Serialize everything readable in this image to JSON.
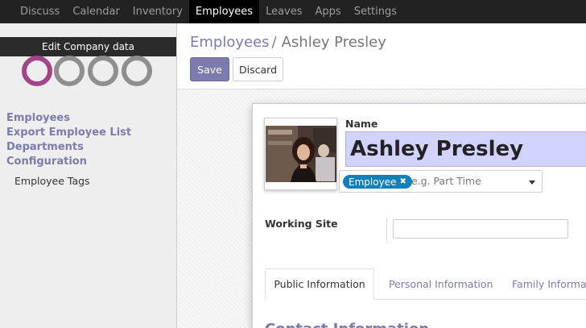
{
  "top_nav": {
    "items": [
      {
        "label": "Discuss"
      },
      {
        "label": "Calendar"
      },
      {
        "label": "Inventory"
      },
      {
        "label": "Employees",
        "active": true
      },
      {
        "label": "Leaves"
      },
      {
        "label": "Apps"
      },
      {
        "label": "Settings"
      }
    ]
  },
  "sidebar": {
    "edit_company_label": "Edit Company data",
    "logo_text": "odoo",
    "menu": [
      {
        "label": "Employees"
      },
      {
        "label": "Export Employee List"
      },
      {
        "label": "Departments"
      },
      {
        "label": "Configuration"
      }
    ],
    "submenu": [
      {
        "label": "Employee Tags"
      }
    ]
  },
  "breadcrumb": {
    "parent": "Employees",
    "separator": "/",
    "current": "Ashley Presley"
  },
  "buttons": {
    "save": "Save",
    "discard": "Discard"
  },
  "form": {
    "name_label": "Name",
    "name_value": "Ashley Presley",
    "tag_label": "Employee",
    "tags_placeholder": "e.g. Part Time",
    "working_site_label": "Working Site",
    "working_site_value": "",
    "tabs": [
      {
        "label": "Public Information",
        "active": true
      },
      {
        "label": "Personal Information"
      },
      {
        "label": "Family Information"
      }
    ],
    "section_heading": "Contact Information"
  },
  "colors": {
    "accent": "#7c7bad",
    "topbar": "#222222",
    "tag": "#0f7fbd",
    "name_field_bg": "#d2d2ff"
  }
}
